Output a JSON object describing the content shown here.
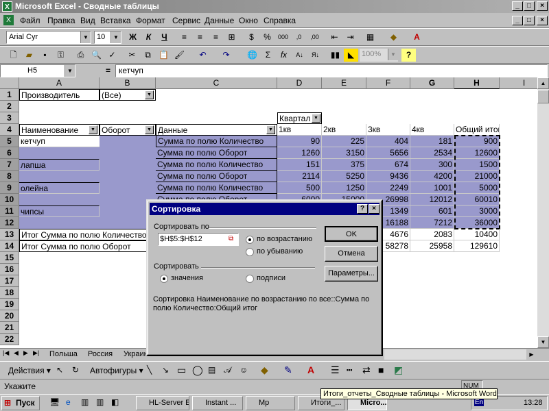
{
  "window": {
    "title": "Microsoft Excel - Сводные таблицы",
    "min": "_",
    "max": "□",
    "close": "×"
  },
  "menu": [
    "Файл",
    "Правка",
    "Вид",
    "Вставка",
    "Формат",
    "Сервис",
    "Данные",
    "Окно",
    "Справка"
  ],
  "format_toolbar": {
    "font": "Arial Cyr",
    "size": "10",
    "bold": "Ж",
    "italic": "К",
    "underline": "Ч",
    "percent": "%",
    "thousands": "000",
    "dec_inc": ",0",
    "dec_dec": ",00"
  },
  "std_toolbar": {
    "sum": "Σ",
    "fx": "fx",
    "zoom": "100%",
    "help": "?"
  },
  "formula_bar": {
    "name_box": "H5",
    "equals": "=",
    "content": "кетчуп"
  },
  "columns": [
    "A",
    "B",
    "C",
    "D",
    "E",
    "F",
    "G",
    "H",
    "I"
  ],
  "rows": [
    "1",
    "2",
    "3",
    "4",
    "5",
    "6",
    "7",
    "8",
    "9",
    "10",
    "11",
    "12",
    "13",
    "14",
    "15",
    "16",
    "17",
    "18",
    "19",
    "20",
    "21",
    "22"
  ],
  "cells": {
    "A1": "Производитель",
    "B1": "(Все)",
    "D3": "Квартал",
    "A4": "Наименование",
    "B4": "Оборот",
    "C4": "Данные",
    "D4": "1кв",
    "E4": "2кв",
    "F4": "3кв",
    "G4": "4кв",
    "H4": "Общий итог",
    "A5": "кетчуп",
    "C5": "Сумма по полю Количество",
    "D5": "90",
    "E5": "225",
    "F5": "404",
    "G5": "181",
    "H5": "900",
    "C6": "Сумма по полю Оборот",
    "D6": "1260",
    "E6": "3150",
    "F6": "5656",
    "G6": "2534",
    "H6": "12600",
    "A7": "лапша",
    "C7": "Сумма по полю Количество",
    "D7": "151",
    "E7": "375",
    "F7": "674",
    "G7": "300",
    "H7": "1500",
    "C8": "Сумма по полю Оборот",
    "D8": "2114",
    "E8": "5250",
    "F8": "9436",
    "G8": "4200",
    "H8": "21000",
    "A9": "олейна",
    "C9": "Сумма по полю Количество",
    "D9": "500",
    "E9": "1250",
    "F9": "2249",
    "G9": "1001",
    "H9": "5000",
    "C10": "Сумма по полю Оборот",
    "D10": "6000",
    "E10": "15000",
    "F10": "26998",
    "G10": "12012",
    "H10": "60010",
    "A11": "чипсы",
    "F11": "1349",
    "G11": "601",
    "H11": "3000",
    "F12": "16188",
    "G12": "7212",
    "H12": "36000",
    "A13": "Итог Сумма по полю Количество",
    "F13": "4676",
    "G13": "2083",
    "H13": "10400",
    "A14": "Итог Сумма по полю Оборот",
    "F14": "58278",
    "G14": "25958",
    "H14": "129610"
  },
  "sheet_tabs": [
    "Польша",
    "Россия",
    "Украина"
  ],
  "dialog": {
    "title": "Сортировка",
    "help": "?",
    "close": "×",
    "sort_by_label": "Сортировать по",
    "sort_by_value": "$H$5:$H$12",
    "ascending": "по возрастанию",
    "descending": "по убыванию",
    "sort_label": "Сортировать",
    "values": "значения",
    "labels": "подписи",
    "ok": "OK",
    "cancel": "Отмена",
    "options": "Параметры...",
    "description_line1": "Сортировка Наименование по возрастанию по все::Сумма по",
    "description_line2": "полю Количество:Общий итог"
  },
  "drawing_toolbar": {
    "actions": "Действия ▾",
    "autoshapes": "Автофигуры ▾"
  },
  "status": {
    "left": "Укажите",
    "num": "NUM"
  },
  "taskbar": {
    "start": "Пуск",
    "tasks": [
      "HL-Server E...",
      "Instant ...",
      "Mp",
      "Итоги_...",
      "Micro..."
    ],
    "clock": "13:28",
    "lang": "En"
  },
  "tooltip": "Итоги_отчеты_Сводные таблицы - Microsoft Word"
}
